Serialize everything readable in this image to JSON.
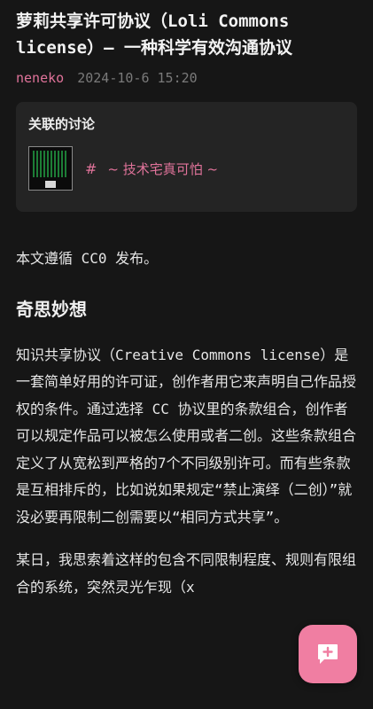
{
  "article": {
    "title": "萝莉共享许可协议（Loli Commons license）— 一种科学有效沟通协议",
    "author": "neneko",
    "date": "2024-10-6 15:20"
  },
  "related": {
    "heading": "关联的讨论",
    "hash": "#",
    "topic": "~ 技术宅真可怕 ~"
  },
  "body": {
    "intro": "本文遵循 CC0 发布。",
    "section_title": "奇思妙想",
    "paragraph1": "知识共享协议（Creative Commons license）是一套简单好用的许可证，创作者用它来声明自己作品授权的条件。通过选择 CC 协议里的条款组合，创作者可以规定作品可以被怎么使用或者二创。这些条款组合定义了从宽松到严格的7个不同级别许可。而有些条款是互相排斥的，比如说如果规定“禁止演绎（二创）”就没必要再限制二创需要以“相同方式共享”。",
    "paragraph2": "某日，我思索着这样的包含不同限制程度、规则有限组合的系统，突然灵光乍现（x"
  },
  "fab": {
    "icon": "add-comment-icon"
  }
}
